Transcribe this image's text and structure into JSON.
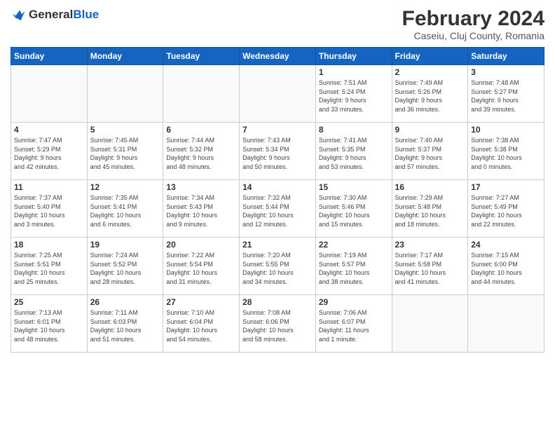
{
  "header": {
    "logo_general": "General",
    "logo_blue": "Blue",
    "title": "February 2024",
    "subtitle": "Caseiu, Cluj County, Romania"
  },
  "days_of_week": [
    "Sunday",
    "Monday",
    "Tuesday",
    "Wednesday",
    "Thursday",
    "Friday",
    "Saturday"
  ],
  "weeks": [
    [
      {
        "day": "",
        "info": ""
      },
      {
        "day": "",
        "info": ""
      },
      {
        "day": "",
        "info": ""
      },
      {
        "day": "",
        "info": ""
      },
      {
        "day": "1",
        "info": "Sunrise: 7:51 AM\nSunset: 5:24 PM\nDaylight: 9 hours\nand 33 minutes."
      },
      {
        "day": "2",
        "info": "Sunrise: 7:49 AM\nSunset: 5:26 PM\nDaylight: 9 hours\nand 36 minutes."
      },
      {
        "day": "3",
        "info": "Sunrise: 7:48 AM\nSunset: 5:27 PM\nDaylight: 9 hours\nand 39 minutes."
      }
    ],
    [
      {
        "day": "4",
        "info": "Sunrise: 7:47 AM\nSunset: 5:29 PM\nDaylight: 9 hours\nand 42 minutes."
      },
      {
        "day": "5",
        "info": "Sunrise: 7:45 AM\nSunset: 5:31 PM\nDaylight: 9 hours\nand 45 minutes."
      },
      {
        "day": "6",
        "info": "Sunrise: 7:44 AM\nSunset: 5:32 PM\nDaylight: 9 hours\nand 48 minutes."
      },
      {
        "day": "7",
        "info": "Sunrise: 7:43 AM\nSunset: 5:34 PM\nDaylight: 9 hours\nand 50 minutes."
      },
      {
        "day": "8",
        "info": "Sunrise: 7:41 AM\nSunset: 5:35 PM\nDaylight: 9 hours\nand 53 minutes."
      },
      {
        "day": "9",
        "info": "Sunrise: 7:40 AM\nSunset: 5:37 PM\nDaylight: 9 hours\nand 57 minutes."
      },
      {
        "day": "10",
        "info": "Sunrise: 7:38 AM\nSunset: 5:38 PM\nDaylight: 10 hours\nand 0 minutes."
      }
    ],
    [
      {
        "day": "11",
        "info": "Sunrise: 7:37 AM\nSunset: 5:40 PM\nDaylight: 10 hours\nand 3 minutes."
      },
      {
        "day": "12",
        "info": "Sunrise: 7:35 AM\nSunset: 5:41 PM\nDaylight: 10 hours\nand 6 minutes."
      },
      {
        "day": "13",
        "info": "Sunrise: 7:34 AM\nSunset: 5:43 PM\nDaylight: 10 hours\nand 9 minutes."
      },
      {
        "day": "14",
        "info": "Sunrise: 7:32 AM\nSunset: 5:44 PM\nDaylight: 10 hours\nand 12 minutes."
      },
      {
        "day": "15",
        "info": "Sunrise: 7:30 AM\nSunset: 5:46 PM\nDaylight: 10 hours\nand 15 minutes."
      },
      {
        "day": "16",
        "info": "Sunrise: 7:29 AM\nSunset: 5:48 PM\nDaylight: 10 hours\nand 18 minutes."
      },
      {
        "day": "17",
        "info": "Sunrise: 7:27 AM\nSunset: 5:49 PM\nDaylight: 10 hours\nand 22 minutes."
      }
    ],
    [
      {
        "day": "18",
        "info": "Sunrise: 7:25 AM\nSunset: 5:51 PM\nDaylight: 10 hours\nand 25 minutes."
      },
      {
        "day": "19",
        "info": "Sunrise: 7:24 AM\nSunset: 5:52 PM\nDaylight: 10 hours\nand 28 minutes."
      },
      {
        "day": "20",
        "info": "Sunrise: 7:22 AM\nSunset: 5:54 PM\nDaylight: 10 hours\nand 31 minutes."
      },
      {
        "day": "21",
        "info": "Sunrise: 7:20 AM\nSunset: 5:55 PM\nDaylight: 10 hours\nand 34 minutes."
      },
      {
        "day": "22",
        "info": "Sunrise: 7:19 AM\nSunset: 5:57 PM\nDaylight: 10 hours\nand 38 minutes."
      },
      {
        "day": "23",
        "info": "Sunrise: 7:17 AM\nSunset: 5:58 PM\nDaylight: 10 hours\nand 41 minutes."
      },
      {
        "day": "24",
        "info": "Sunrise: 7:15 AM\nSunset: 6:00 PM\nDaylight: 10 hours\nand 44 minutes."
      }
    ],
    [
      {
        "day": "25",
        "info": "Sunrise: 7:13 AM\nSunset: 6:01 PM\nDaylight: 10 hours\nand 48 minutes."
      },
      {
        "day": "26",
        "info": "Sunrise: 7:11 AM\nSunset: 6:03 PM\nDaylight: 10 hours\nand 51 minutes."
      },
      {
        "day": "27",
        "info": "Sunrise: 7:10 AM\nSunset: 6:04 PM\nDaylight: 10 hours\nand 54 minutes."
      },
      {
        "day": "28",
        "info": "Sunrise: 7:08 AM\nSunset: 6:06 PM\nDaylight: 10 hours\nand 58 minutes."
      },
      {
        "day": "29",
        "info": "Sunrise: 7:06 AM\nSunset: 6:07 PM\nDaylight: 11 hours\nand 1 minute."
      },
      {
        "day": "",
        "info": ""
      },
      {
        "day": "",
        "info": ""
      }
    ]
  ]
}
